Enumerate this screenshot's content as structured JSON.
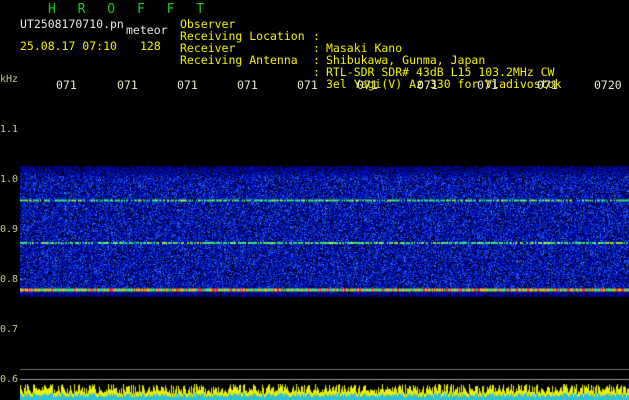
{
  "header": {
    "brand": "H R O F F T",
    "file_name": "UT2508170710.pn",
    "file_tag": "meteor",
    "datetime": "25.08.17 07:10",
    "value": "128",
    "meta": [
      {
        "key": "Observer",
        "value": "Masaki Kano"
      },
      {
        "key": "Receiving Location",
        "value": "Shibukawa, Gunma, Japan"
      },
      {
        "key": "Receiver",
        "value": "RTL-SDR SDR# 43dB L15 103.2MHz CW"
      },
      {
        "key": "Receiving Antenna",
        "value": "3el Yagi(V) Az 330 for Vladivostok"
      }
    ],
    "separator": ":"
  },
  "axis": {
    "unit": "kHz",
    "y_labels": [
      "1.1",
      "1.0",
      "0.9",
      "0.8",
      "0.7",
      "0.6"
    ],
    "x_ticks": [
      "071",
      "071",
      "071",
      "071",
      "071",
      "071",
      "071",
      "071",
      "071",
      "0720"
    ]
  },
  "spectrogram": {
    "y_range_khz": [
      0.6,
      1.15
    ],
    "noise_band_khz": [
      0.77,
      1.03
    ],
    "carrier_lines_khz": [
      0.785,
      0.88,
      0.965
    ],
    "colors": {
      "background": "#000000",
      "band": "#0a1cc8",
      "carrier": "#ff3030",
      "green_line": "#30e080",
      "audio_bar_yellow": "#f0f000",
      "audio_bar_cyan": "#30c0d0"
    }
  }
}
